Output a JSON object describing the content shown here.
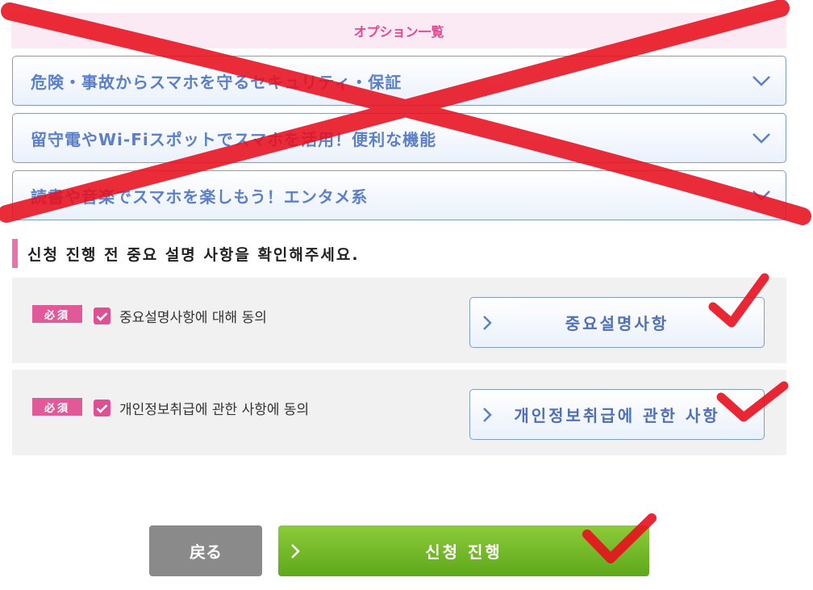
{
  "options": {
    "header": "オプション一覧",
    "items": [
      {
        "label": "危険・事故からスマホを守るセキュリティ・保証"
      },
      {
        "label": "留守電やWi-Fiスポットでスマホを活用！便利な機能"
      },
      {
        "label": "読書や音楽でスマホを楽しもう！エンタメ系"
      }
    ]
  },
  "confirm": {
    "title": "신청 진행 전 중요 설명 사항을 확인해주세요.",
    "items": [
      {
        "badge": "必須",
        "label": "중요설명사항에 대해 동의",
        "checked": true,
        "button": "중요설명사항"
      },
      {
        "badge": "必須",
        "label": "개인정보취급에 관한 사항에 동의",
        "checked": true,
        "button": "개인정보취급에 관한 사항"
      }
    ]
  },
  "actions": {
    "back": "戻る",
    "submit": "신청 진행"
  },
  "colors": {
    "accent_pink": "#e8468f",
    "accent_blue": "#5b7fc9",
    "submit_green": "#6cb524",
    "annotation_red": "#e8101e"
  }
}
